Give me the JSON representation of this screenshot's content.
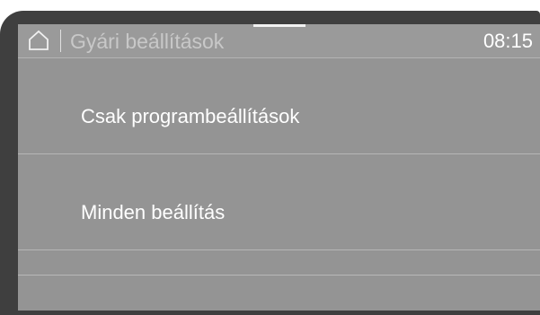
{
  "header": {
    "home_icon": "home-icon",
    "title": "Gyári beállítások",
    "time": "08:15"
  },
  "menu": {
    "items": [
      {
        "label": "Csak programbeállítások"
      },
      {
        "label": "Minden beállítás"
      }
    ]
  },
  "colors": {
    "screen_bg": "#949494",
    "bezel": "#3f3f3f",
    "text": "#ffffff",
    "title_text": "#c8c8c8"
  }
}
